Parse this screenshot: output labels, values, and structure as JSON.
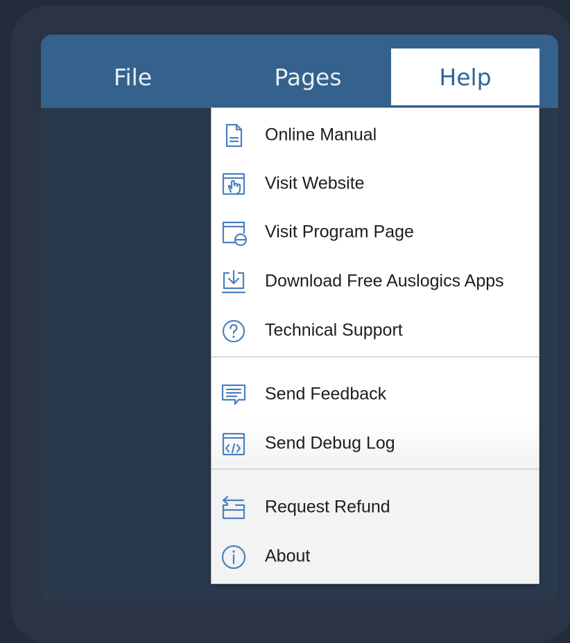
{
  "menubar": {
    "tabs": [
      {
        "label": "File"
      },
      {
        "label": "Pages"
      },
      {
        "label": "Help"
      }
    ],
    "active_tab": "Help"
  },
  "help_menu": {
    "groups": [
      {
        "items": [
          {
            "label": "Online Manual",
            "icon": "document-icon"
          },
          {
            "label": "Visit Website",
            "icon": "browser-hand-icon"
          },
          {
            "label": "Visit Program Page",
            "icon": "browser-globe-icon"
          },
          {
            "label": "Download Free Auslogics Apps",
            "icon": "download-icon"
          },
          {
            "label": "Technical Support",
            "icon": "question-icon"
          }
        ]
      },
      {
        "items": [
          {
            "label": "Send Feedback",
            "icon": "feedback-icon"
          },
          {
            "label": "Send Debug Log",
            "icon": "code-window-icon"
          }
        ]
      },
      {
        "items": [
          {
            "label": "Request Refund",
            "icon": "refund-icon"
          },
          {
            "label": "About",
            "icon": "info-icon"
          }
        ]
      }
    ]
  },
  "colors": {
    "background": "#222c3a",
    "menubar": "#34628d",
    "active_tab_text": "#2f6598",
    "icon": "#4b7fc0"
  }
}
